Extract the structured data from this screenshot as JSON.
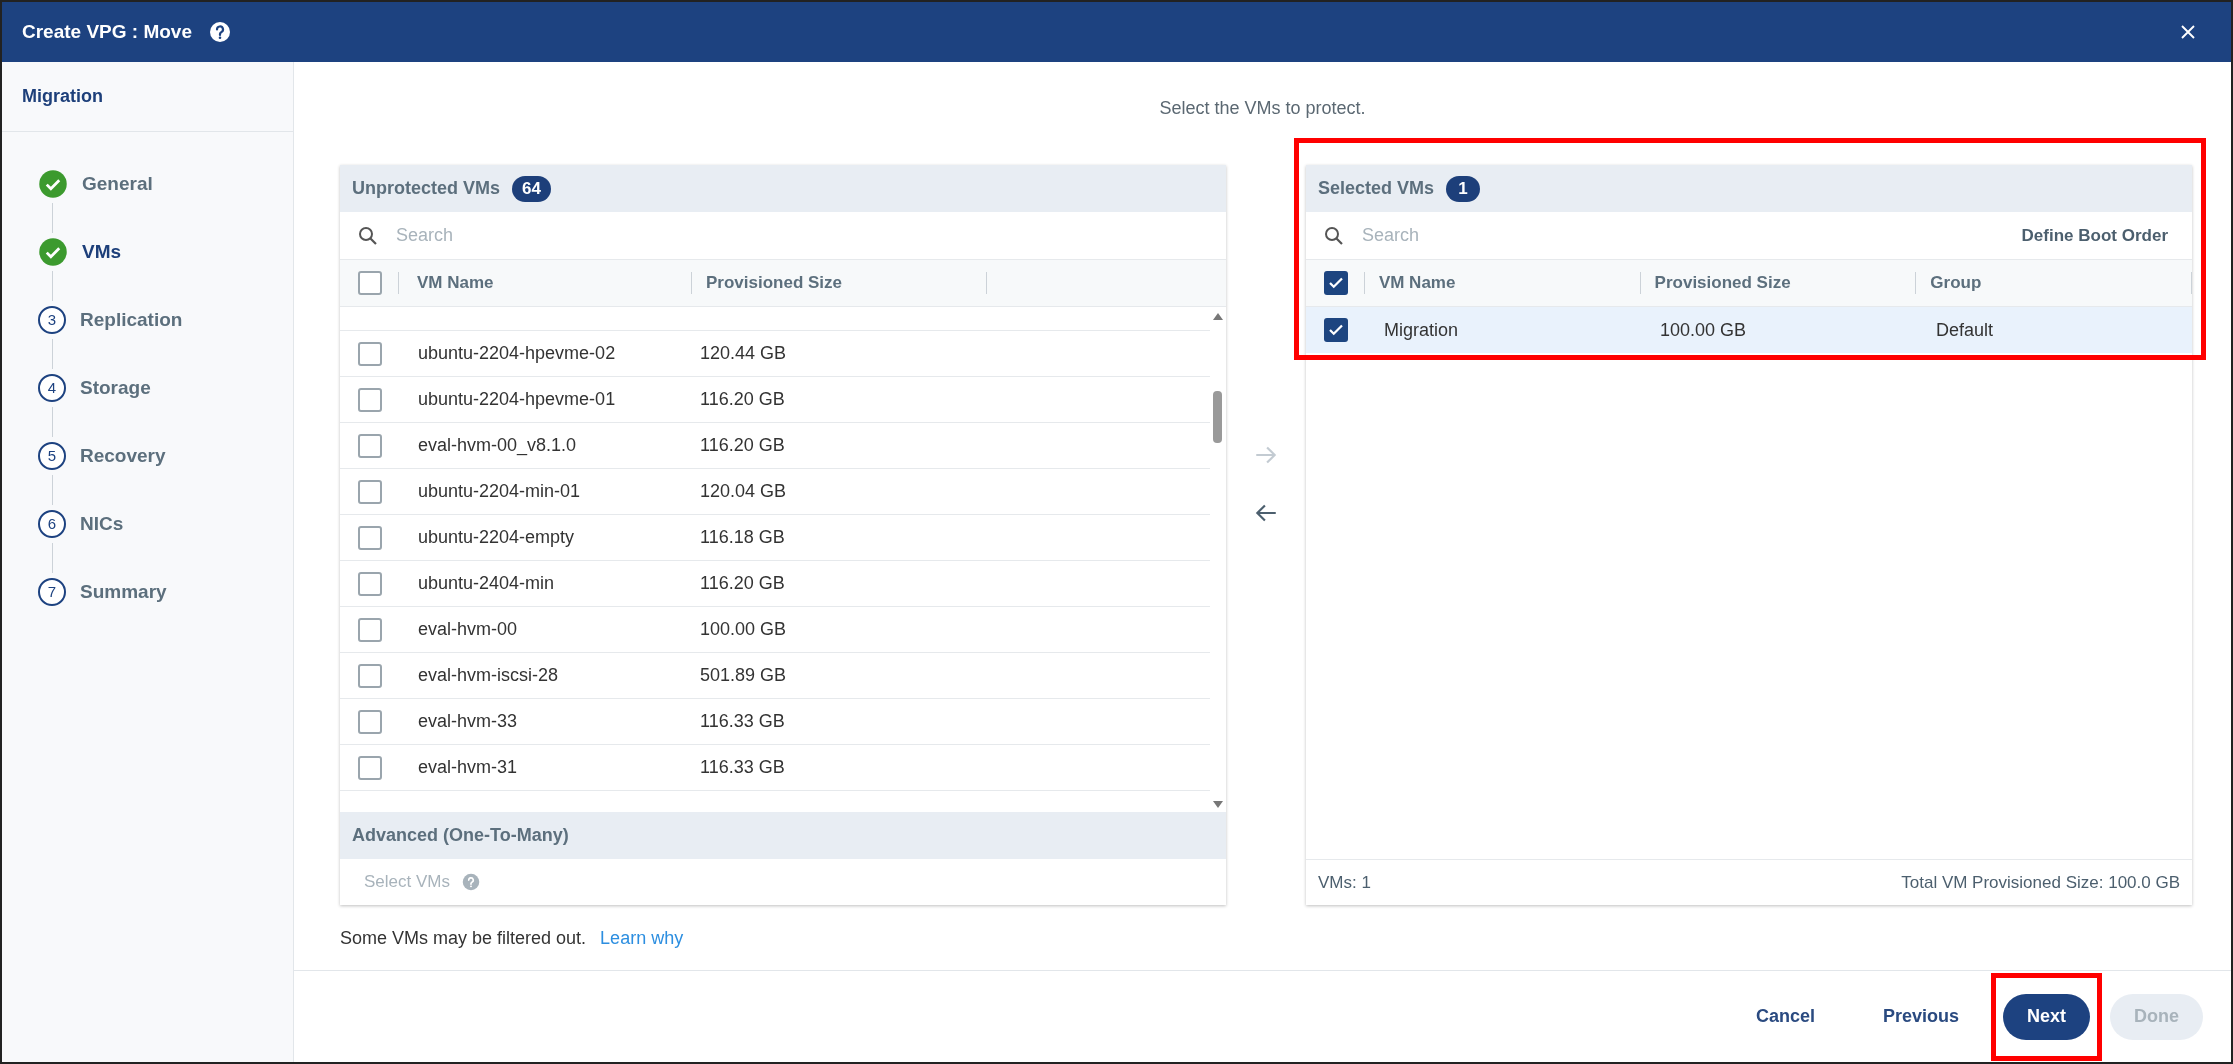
{
  "window": {
    "title": "Create VPG : Move"
  },
  "sidebar": {
    "title": "Migration",
    "steps": [
      {
        "label": "General",
        "completed": true,
        "selected": false
      },
      {
        "label": "VMs",
        "completed": true,
        "selected": true
      },
      {
        "label": "Replication",
        "number": "3",
        "completed": false,
        "selected": false
      },
      {
        "label": "Storage",
        "number": "4",
        "completed": false,
        "selected": false
      },
      {
        "label": "Recovery",
        "number": "5",
        "completed": false,
        "selected": false
      },
      {
        "label": "NICs",
        "number": "6",
        "completed": false,
        "selected": false
      },
      {
        "label": "Summary",
        "number": "7",
        "completed": false,
        "selected": false
      }
    ]
  },
  "instruction": "Select the VMs to protect.",
  "unprotected_vms": {
    "title": "Unprotected VMs",
    "count": "64",
    "search": {
      "placeholder": "Search"
    },
    "all_checked": false,
    "columns": [
      "VM Name",
      "Provisioned Size"
    ],
    "rows": [
      {
        "name": "ubuntu-2204-hpevme-02",
        "size": "120.44 GB",
        "checked": false
      },
      {
        "name": "ubuntu-2204-hpevme-01",
        "size": "116.20 GB",
        "checked": false
      },
      {
        "name": "eval-hvm-00_v8.1.0",
        "size": "116.20 GB",
        "checked": false
      },
      {
        "name": "ubuntu-2204-min-01",
        "size": "120.04 GB",
        "checked": false
      },
      {
        "name": "ubuntu-2204-empty",
        "size": "116.18 GB",
        "checked": false
      },
      {
        "name": "ubuntu-2404-min",
        "size": "116.20 GB",
        "checked": false
      },
      {
        "name": "eval-hvm-00",
        "size": "100.00 GB",
        "checked": false
      },
      {
        "name": "eval-hvm-iscsi-28",
        "size": "501.89 GB",
        "checked": false
      },
      {
        "name": "eval-hvm-33",
        "size": "116.33 GB",
        "checked": false
      },
      {
        "name": "eval-hvm-31",
        "size": "116.33 GB",
        "checked": false
      }
    ],
    "advanced": {
      "title": "Advanced (One-To-Many)",
      "select_label": "Select VMs"
    }
  },
  "filter_note": {
    "text": "Some VMs may be filtered out.",
    "link": "Learn why"
  },
  "selected_vms": {
    "title": "Selected VMs",
    "count": "1",
    "highlighted": true,
    "search": {
      "placeholder": "Search"
    },
    "boot_order": "Define Boot Order",
    "all_checked": true,
    "columns": [
      "VM Name",
      "Provisioned Size",
      "Group"
    ],
    "rows": [
      {
        "name": "Migration",
        "size": "100.00 GB",
        "group": "Default",
        "checked": true
      }
    ],
    "footer_count": "VMs: 1",
    "footer_total": "Total VM Provisioned Size: 100.0 GB"
  },
  "buttons": [
    {
      "label": "Cancel",
      "kind": "text",
      "disabled": false,
      "highlighted": false
    },
    {
      "label": "Previous",
      "kind": "text",
      "disabled": false,
      "highlighted": false
    },
    {
      "label": "Next",
      "kind": "primary",
      "disabled": false,
      "highlighted": true
    },
    {
      "label": "Done",
      "kind": "primary",
      "disabled": true,
      "highlighted": false
    }
  ]
}
